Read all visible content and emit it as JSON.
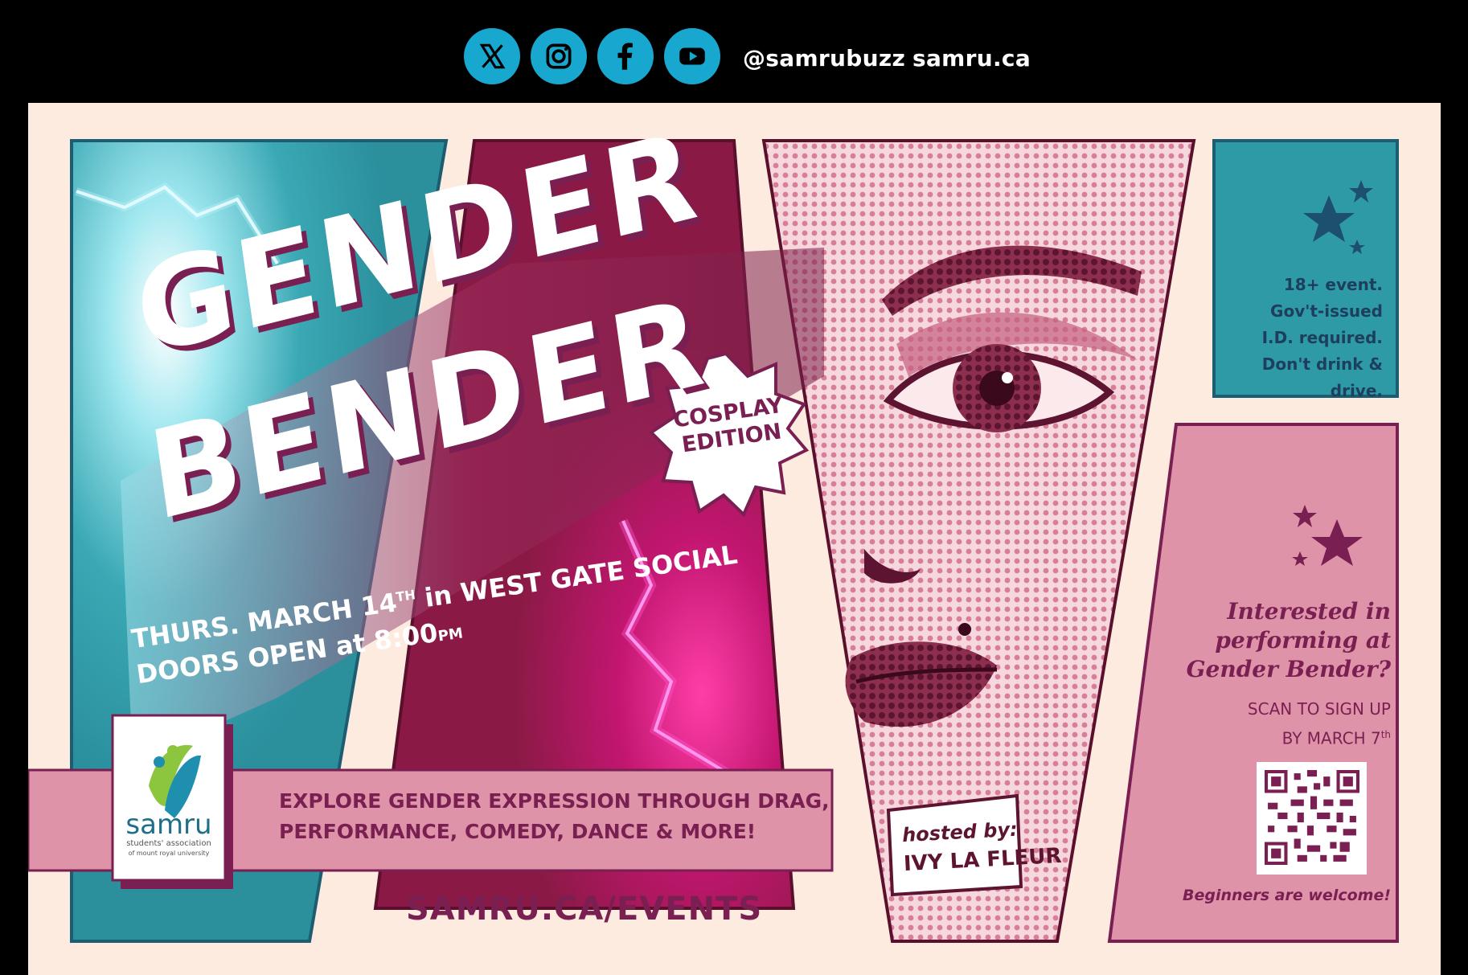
{
  "social_bar": {
    "handle": "@samrubuzz",
    "website": "samru.ca",
    "icons": [
      "x-icon",
      "instagram-icon",
      "facebook-icon",
      "youtube-icon"
    ]
  },
  "poster": {
    "title_line1": "GENDER",
    "title_line2": "BENDER",
    "badge_line1": "COSPLAY",
    "badge_line2": "EDITION",
    "date_line": "THURS. MARCH 14",
    "date_suffix": "TH",
    "venue_line": " in WEST GATE SOCIAL",
    "doors_line": "DOORS OPEN at 8:00",
    "doors_suffix": "PM",
    "tagline_line1": "EXPLORE GENDER EXPRESSION THROUGH DRAG,",
    "tagline_line2": "PERFORMANCE, COMEDY, DANCE & MORE!",
    "url": "SAMRU.CA/EVENTS",
    "hosted_label": "hosted by:",
    "host_name": "IVY LA FLEUR",
    "notice_lines": [
      "18+ event.",
      "Gov't-issued",
      "I.D. required.",
      "Don't drink & drive."
    ],
    "perform_lines": [
      "Interested in",
      "performing at",
      "Gender Bender?"
    ],
    "signup_line1": "SCAN TO SIGN UP",
    "signup_line2": "BY MARCH 7",
    "signup_suffix": "th",
    "beginners": "Beginners are welcome!",
    "logo_name": "samru",
    "logo_sub1": "students' association",
    "logo_sub2": "of mount royal university"
  },
  "colors": {
    "teal": "#2b9aa6",
    "maroon": "#8a1a45",
    "pink": "#df93a8",
    "purple_text": "#7a1f52",
    "cream": "#fdebe0",
    "social_blue": "#18a7cf"
  }
}
